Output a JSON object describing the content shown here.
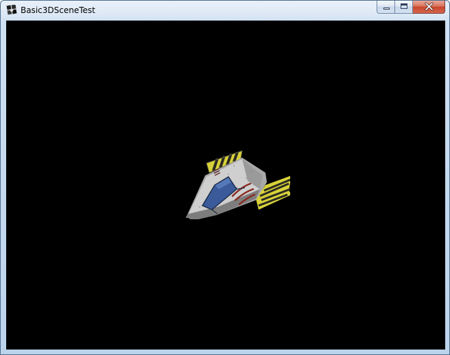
{
  "window": {
    "title": "Basic3DSceneTest",
    "app_icon": "xna-app-icon"
  },
  "caption_buttons": {
    "minimize_icon": "minimize-icon",
    "maximize_icon": "maximize-icon",
    "close_icon": "close-icon"
  },
  "scene": {
    "background_color": "#000000",
    "model": "spaceship-model",
    "colors": {
      "hull": "#b8b8b8",
      "cockpit": "#3a5a9a",
      "stripe_yellow": "#d8d23a",
      "stripe_dark": "#2a2a22",
      "marking_red": "#8a2a22"
    }
  }
}
